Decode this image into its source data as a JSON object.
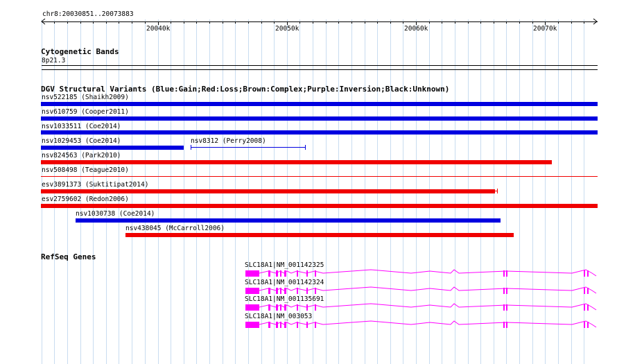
{
  "ruler": {
    "location": "chr8:20030851..20073883",
    "ticks": [
      "20040k",
      "20050k",
      "20060k",
      "20070k"
    ]
  },
  "cytogenetic": {
    "title": "Cytogenetic Bands",
    "band": "8p21.3"
  },
  "dgv": {
    "title": "DGV Structural Variants (Blue:Gain;Red:Loss;Brown:Complex;Purple:Inversion;Black:Unknown)",
    "colors": {
      "gain": "#0000e0",
      "loss": "#f00000"
    },
    "variants": [
      {
        "id": "nsv522185",
        "label": "nsv522185 (Shaikh2009)",
        "type": "gain"
      },
      {
        "id": "nsv610759",
        "label": "nsv610759 (Cooper2011)",
        "type": "gain"
      },
      {
        "id": "nsv1033511",
        "label": "nsv1033511 (Coe2014)",
        "type": "gain"
      },
      {
        "id": "nsv1029453",
        "label": "nsv1029453 (Coe2014)",
        "type": "gain"
      },
      {
        "id": "nsv8312",
        "label": "nsv8312 (Perry2008)",
        "type": "gain"
      },
      {
        "id": "nsv824563",
        "label": "nsv824563 (Park2010)",
        "type": "loss"
      },
      {
        "id": "nsv508498",
        "label": "nsv508498 (Teague2010)",
        "type": "loss"
      },
      {
        "id": "esv3891373",
        "label": "esv3891373 (Suktitipat2014)",
        "type": "loss"
      },
      {
        "id": "esv2759602",
        "label": "esv2759602 (Redon2006)",
        "type": "loss"
      },
      {
        "id": "nsv1030738",
        "label": "nsv1030738 (Coe2014)",
        "type": "gain"
      },
      {
        "id": "nsv438045",
        "label": "nsv438045 (McCarroll2006)",
        "type": "loss"
      }
    ]
  },
  "refseq": {
    "title": "RefSeq Genes",
    "color": "#ff00ff",
    "transcripts": [
      {
        "label": "SLC18A1|NM_001142325"
      },
      {
        "label": "SLC18A1|NM_001142324"
      },
      {
        "label": "SLC18A1|NM_001135691"
      },
      {
        "label": "SLC18A1|NM_003053"
      }
    ]
  }
}
